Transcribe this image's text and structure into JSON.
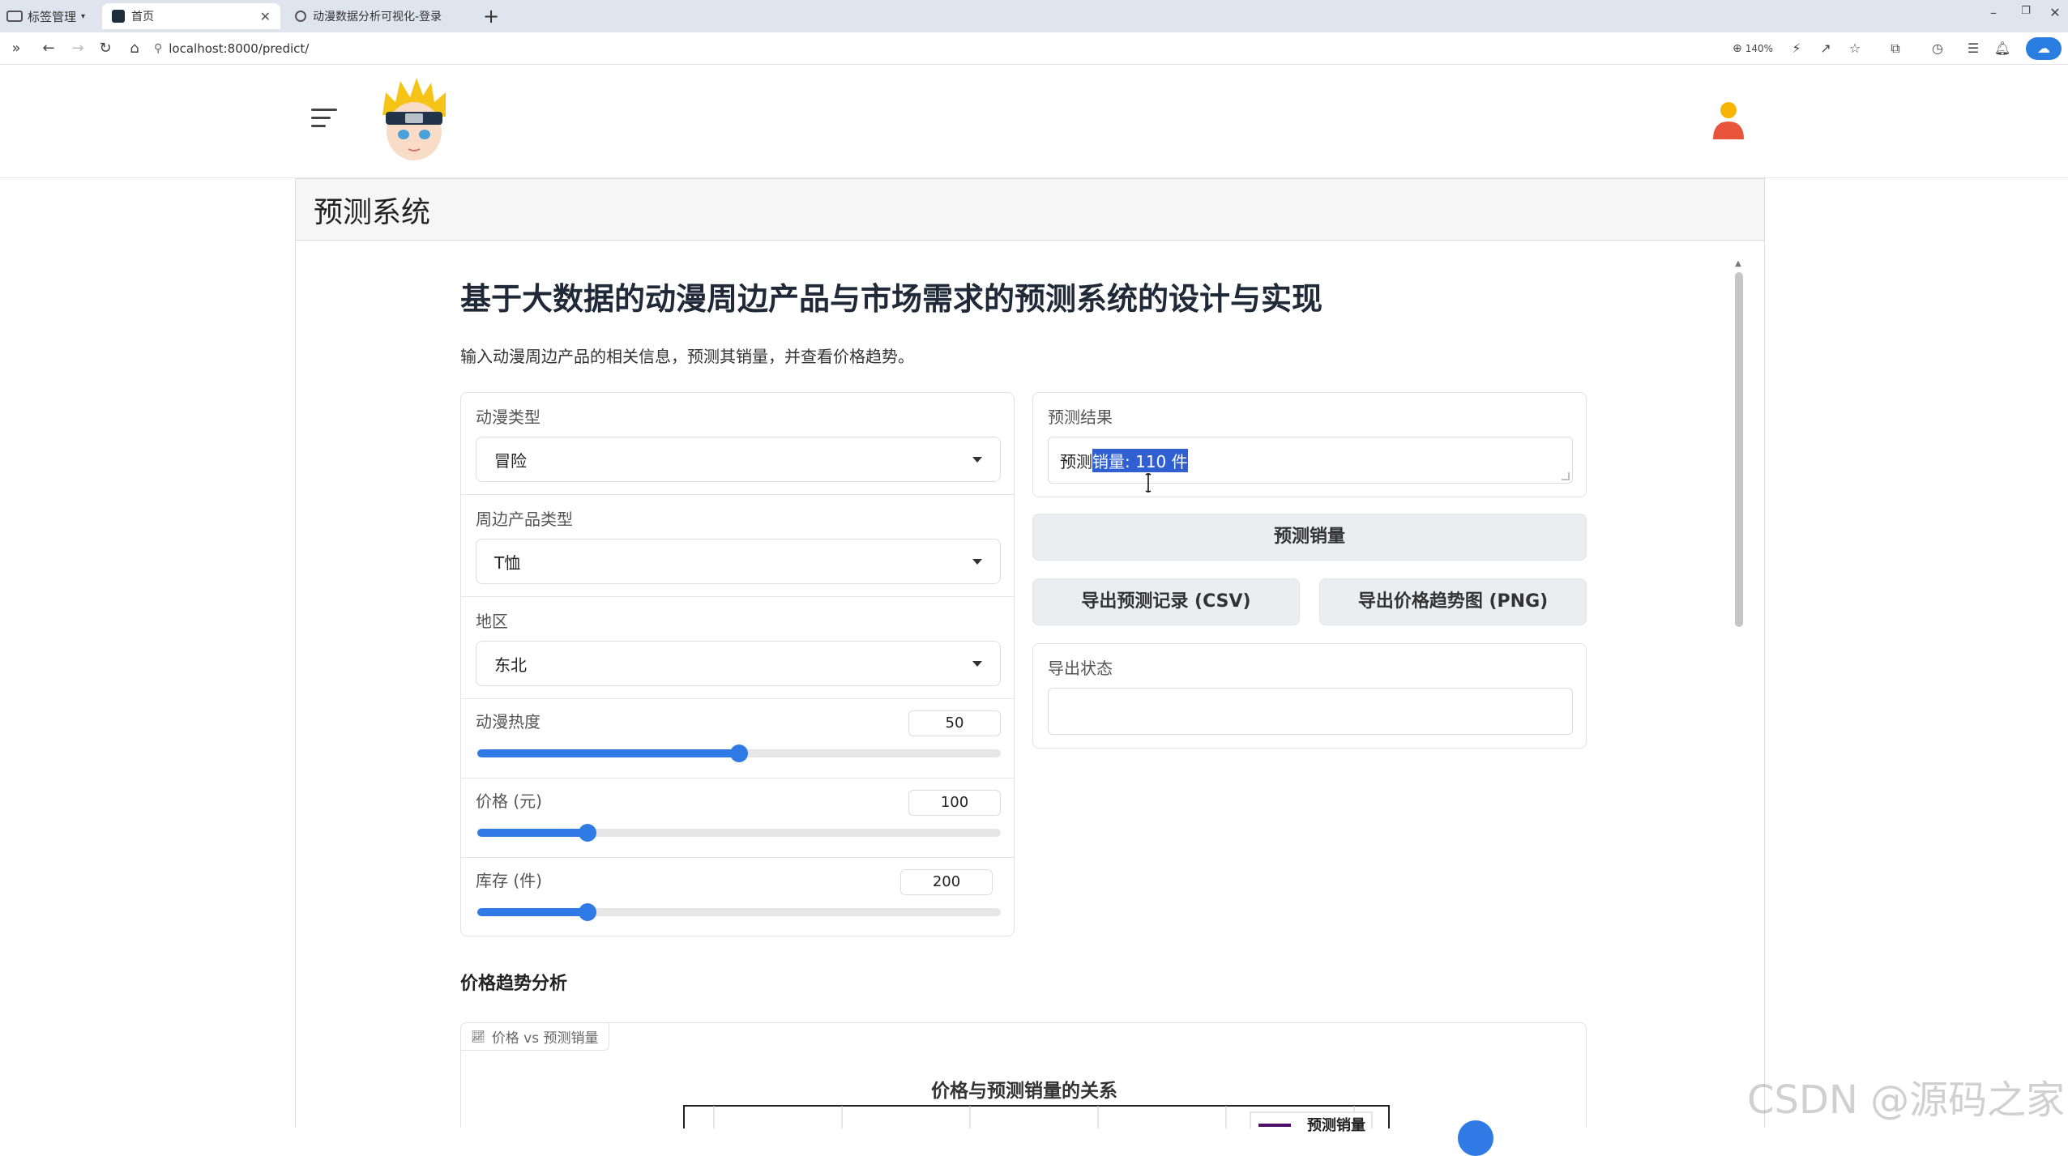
{
  "browser": {
    "tab_group_label": "标签管理",
    "tabs": [
      {
        "title": "首页",
        "active": true
      },
      {
        "title": "动漫数据分析可视化-登录",
        "active": false
      }
    ],
    "url": "localhost:8000/predict/",
    "zoom": "140%"
  },
  "header": {
    "logo_icon": "naruto-avatar-icon",
    "user_icon": "user-icon"
  },
  "panel": {
    "title": "预测系统"
  },
  "app": {
    "title": "基于大数据的动漫周边产品与市场需求的预测系统的设计与实现",
    "description": "输入动漫周边产品的相关信息，预测其销量，并查看价格趋势。"
  },
  "form": {
    "anime_type": {
      "label": "动漫类型",
      "value": "冒险"
    },
    "product_type": {
      "label": "周边产品类型",
      "value": "T恤"
    },
    "region": {
      "label": "地区",
      "value": "东北"
    },
    "popularity": {
      "label": "动漫热度",
      "value": "50",
      "fraction": 0.5
    },
    "price": {
      "label": "价格 (元)",
      "value": "100",
      "fraction": 0.21
    },
    "stock": {
      "label": "库存 (件)",
      "value": "200",
      "fraction": 0.21
    }
  },
  "result": {
    "label": "预测结果",
    "text_prefix": "预测",
    "text_selected": "销量: 110 件"
  },
  "buttons": {
    "predict": "预测销量",
    "export_csv": "导出预测记录 (CSV)",
    "export_png": "导出价格趋势图 (PNG)"
  },
  "export_status": {
    "label": "导出状态",
    "value": ""
  },
  "trend": {
    "section_title": "价格趋势分析",
    "chip_label": "价格 vs 预测销量",
    "chart_title": "价格与预测销量的关系",
    "legend_label": "预测销量"
  },
  "watermark": "CSDN @源码之家",
  "colors": {
    "accent": "#2f7ae5",
    "selection": "#2f5fd0",
    "legend_swatch": "#4b0f6b"
  }
}
